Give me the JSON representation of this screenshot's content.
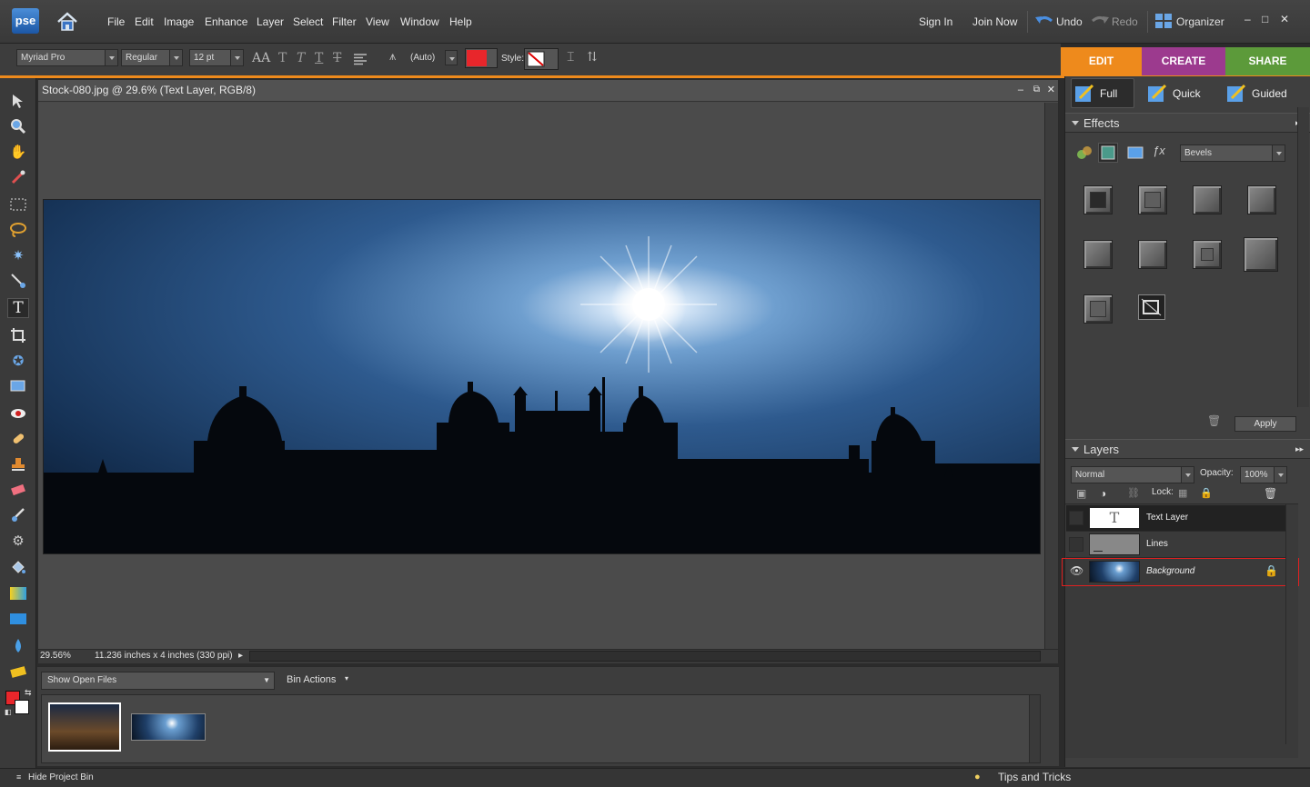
{
  "app": {
    "logo": "pse"
  },
  "menu": [
    "File",
    "Edit",
    "Image",
    "Enhance",
    "Layer",
    "Select",
    "Filter",
    "View",
    "Window",
    "Help"
  ],
  "header_right": {
    "sign_in": "Sign In",
    "join_now": "Join Now",
    "undo": "Undo",
    "redo": "Redo",
    "organizer": "Organizer"
  },
  "options": {
    "font_family": "Myriad Pro",
    "font_style": "Regular",
    "font_size": "12 pt",
    "leading": "(Auto)",
    "style_label": "Style:",
    "text_color": "#e8262b"
  },
  "mode_tabs": [
    {
      "label": "EDIT",
      "color": "#ee8a1c"
    },
    {
      "label": "CREATE",
      "color": "#9c3a8e"
    },
    {
      "label": "SHARE",
      "color": "#5c9a3a"
    }
  ],
  "edit_subtabs": [
    "Full",
    "Quick",
    "Guided"
  ],
  "document": {
    "title": "Stock-080.jpg @ 29.6% (Text Layer, RGB/8)",
    "zoom": "29.56%",
    "size": "11.236 inches x 4 inches (330 ppi)"
  },
  "bin": {
    "show_label": "Show Open Files",
    "actions_label": "Bin Actions"
  },
  "bottom": {
    "hide_bin": "Hide Project Bin",
    "tips": "Tips and Tricks"
  },
  "effects": {
    "title": "Effects",
    "category": "Bevels",
    "apply": "Apply"
  },
  "layers": {
    "title": "Layers",
    "blend_mode": "Normal",
    "opacity_label": "Opacity:",
    "opacity": "100%",
    "lock_label": "Lock:",
    "items": [
      {
        "name": "Text Layer"
      },
      {
        "name": "Lines"
      },
      {
        "name": "Background"
      }
    ]
  }
}
